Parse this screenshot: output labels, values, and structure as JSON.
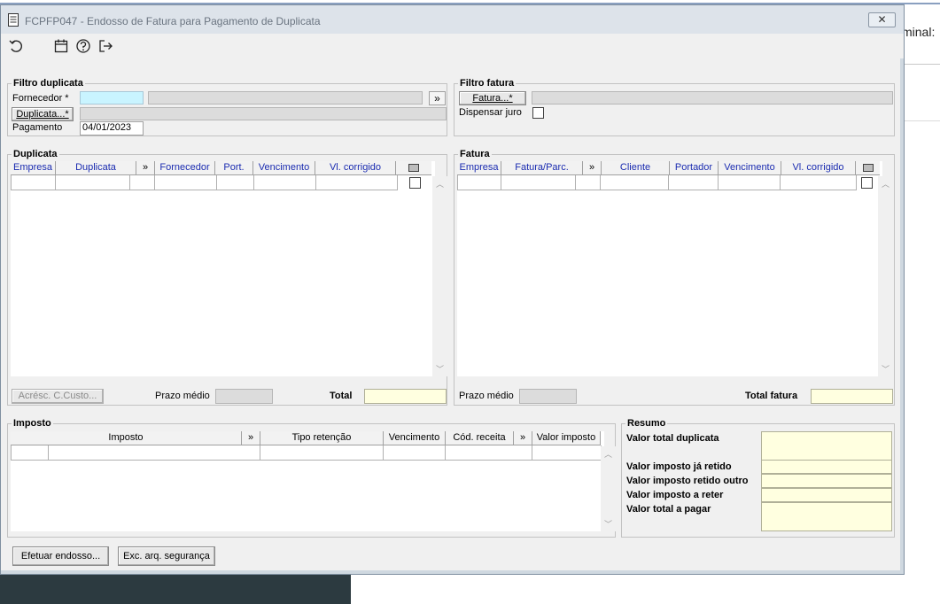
{
  "background": {
    "right_text": "minal:"
  },
  "window": {
    "title": "FCPFP047 - Endosso de Fatura para Pagamento de Duplicata",
    "close_label": "✕"
  },
  "toolbar": {
    "icons": [
      "undo-icon",
      "calendar-icon",
      "help-icon",
      "exit-icon"
    ]
  },
  "filtro_duplicata": {
    "title": "Filtro duplicata",
    "fornecedor_label": "Fornecedor *",
    "fornecedor_code": "",
    "fornecedor_name": "",
    "chevron": "»",
    "duplicata_button": "Duplicata...*",
    "duplicata_value": "",
    "pagamento_label": "Pagamento",
    "pagamento_value": "04/01/2023"
  },
  "filtro_fatura": {
    "title": "Filtro fatura",
    "fatura_button": "Fatura...*",
    "fatura_value": "",
    "dispensar_label": "Dispensar juro",
    "dispensar_checked": false
  },
  "duplicata": {
    "title": "Duplicata",
    "columns": [
      "Empresa",
      "Duplicata",
      "»",
      "Fornecedor",
      "Port.",
      "Vencimento",
      "Vl. corrigido"
    ],
    "acresc_button": "Acrésc. C.Custo...",
    "prazo_label": "Prazo médio",
    "prazo_value": "",
    "total_label": "Total",
    "total_value": ""
  },
  "fatura": {
    "title": "Fatura",
    "columns": [
      "Empresa",
      "Fatura/Parc.",
      "»",
      "Cliente",
      "Portador",
      "Vencimento",
      "Vl. corrigido"
    ],
    "prazo_label": "Prazo médio",
    "prazo_value": "",
    "total_label": "Total fatura",
    "total_value": ""
  },
  "imposto": {
    "title": "Imposto",
    "columns": [
      "Imposto",
      "»",
      "Tipo retenção",
      "Vencimento",
      "Cód. receita",
      "»",
      "Valor imposto"
    ]
  },
  "resumo": {
    "title": "Resumo",
    "valor_total_duplicata": "Valor total duplicata",
    "valor_imposto_retido": "Valor imposto já retido",
    "valor_imposto_outro": "Valor imposto retido outro",
    "valor_imposto_reter": "Valor imposto a reter",
    "valor_total_pagar": "Valor total a pagar"
  },
  "footer": {
    "efetuar_button": "Efetuar endosso...",
    "exc_button": "Exc. arq. segurança"
  }
}
